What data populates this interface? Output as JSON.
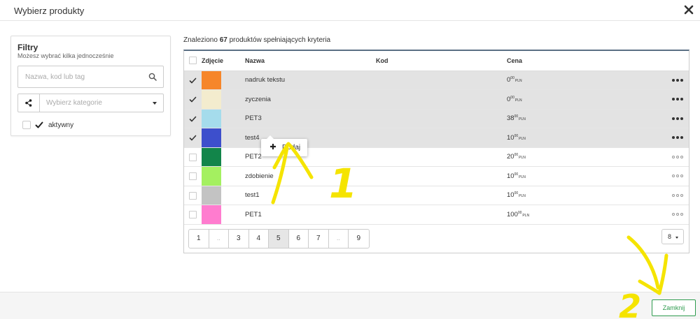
{
  "modal": {
    "title": "Wybierz produkty"
  },
  "filters": {
    "title": "Filtry",
    "subtitle": "Możesz wybrać kilka jednocześnie",
    "search_placeholder": "Nazwa, kod lub tag",
    "category_placeholder": "Wybierz kategorie",
    "active_label": "aktywny",
    "active_checked": true
  },
  "results": {
    "found_prefix": "Znaleziono",
    "found_count": "67",
    "found_suffix": "produktów spełniających kryteria",
    "columns": {
      "photo": "Zdjęcie",
      "name": "Nazwa",
      "code": "Kod",
      "price": "Cena"
    },
    "rows": [
      {
        "name": "nadruk tekstu",
        "price_int": "0",
        "price_dec": "00",
        "currency": "PLN",
        "color": "#f6862a",
        "selected": true
      },
      {
        "name": "zyczenia",
        "price_int": "0",
        "price_dec": "00",
        "currency": "PLN",
        "color": "#f3ecce",
        "selected": true
      },
      {
        "name": "PET3",
        "price_int": "38",
        "price_dec": "00",
        "currency": "PLN",
        "color": "#a5dcec",
        "selected": true
      },
      {
        "name": "test4",
        "price_int": "10",
        "price_dec": "00",
        "currency": "PLN",
        "color": "#3d4fcc",
        "selected": true
      },
      {
        "name": "PET2",
        "price_int": "20",
        "price_dec": "00",
        "currency": "PLN",
        "color": "#12854a",
        "selected": false
      },
      {
        "name": "zdobienie",
        "price_int": "10",
        "price_dec": "00",
        "currency": "PLN",
        "color": "#a4f060",
        "selected": false
      },
      {
        "name": "test1",
        "price_int": "10",
        "price_dec": "00",
        "currency": "PLN",
        "color": "#c3c3c3",
        "selected": false
      },
      {
        "name": "PET1",
        "price_int": "100",
        "price_dec": "00",
        "currency": "PLN",
        "color": "#ff7ccf",
        "selected": false
      }
    ]
  },
  "add_popup": {
    "label": "Dodaj"
  },
  "pagination": {
    "pages": [
      "1",
      "..",
      "3",
      "4",
      "5",
      "6",
      "7",
      "..",
      "9"
    ],
    "current": "5",
    "per_page": "8"
  },
  "footer": {
    "close_label": "Zamknij"
  },
  "annotations": {
    "label_1": "1",
    "label_2": "2",
    "color": "#f5e400"
  },
  "icons": {
    "close": "close-icon",
    "search": "search-icon",
    "share": "share-icon",
    "check": "check-icon",
    "plus": "plus-icon",
    "more": "more-icon"
  }
}
